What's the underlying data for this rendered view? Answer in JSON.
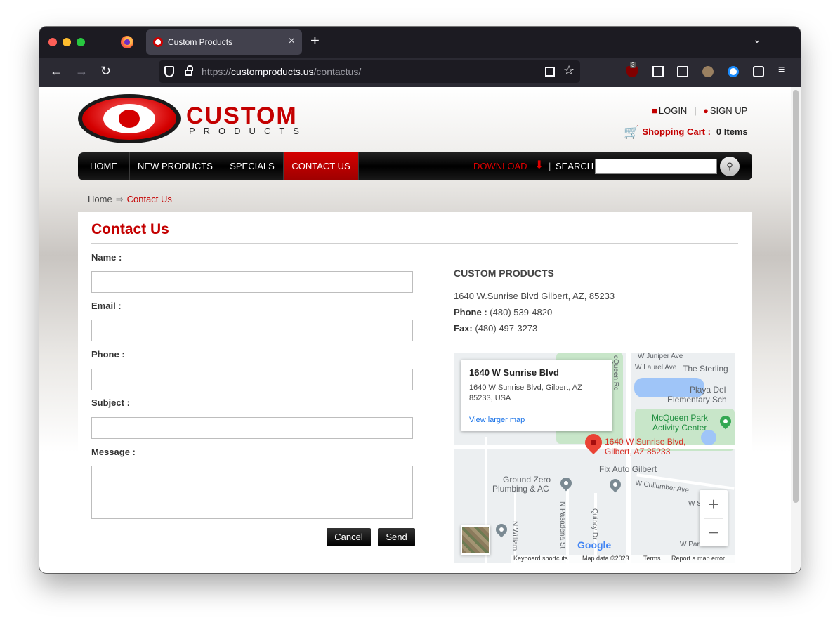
{
  "browser": {
    "tab_title": "Custom Products",
    "tab_close": "×",
    "new_tab": "+",
    "tab_list": "⌄",
    "url_scheme": "https://",
    "url_host": "customproducts.us",
    "url_path": "/contactus/",
    "ublock_badge": "3",
    "nav_back": "←",
    "nav_forward": "→",
    "nav_reload": "↻",
    "bookmark_star": "☆",
    "menu": "≡"
  },
  "header": {
    "logo_title": "CUSTOM",
    "logo_subtitle": "PRODUCTS",
    "login": "LOGIN",
    "account_sep": "|",
    "signup": "SIGN UP",
    "cart_label": "Shopping Cart :",
    "cart_count": "0 Items"
  },
  "nav": {
    "items": [
      "HOME",
      "NEW PRODUCTS",
      "SPECIALS",
      "CONTACT US"
    ],
    "active": "CONTACT US",
    "download": "DOWNLOAD",
    "separator": "|",
    "search_label": "SEARCH",
    "search_value": ""
  },
  "breadcrumb": {
    "home": "Home",
    "separator": "⇒",
    "current": "Contact Us"
  },
  "contact": {
    "title": "Contact Us",
    "fields": {
      "name_label": "Name :",
      "email_label": "Email :",
      "phone_label": "Phone :",
      "subject_label": "Subject :",
      "message_label": "Message :",
      "name_value": "",
      "email_value": "",
      "phone_value": "",
      "subject_value": "",
      "message_value": ""
    },
    "cancel_label": "Cancel",
    "send_label": "Send"
  },
  "company": {
    "name": "CUSTOM PRODUCTS",
    "address": "1640 W.Sunrise Blvd Gilbert, AZ, 85233",
    "phone_label": "Phone :",
    "phone": "(480) 539-4820",
    "fax_label": "Fax:",
    "fax": "(480) 497-3273"
  },
  "map": {
    "card_title": "1640 W Sunrise Blvd",
    "card_address": "1640 W Sunrise Blvd, Gilbert, AZ 85233, USA",
    "card_link": "View larger map",
    "pin_label_1": "1640 W Sunrise Blvd,",
    "pin_label_2": "Gilbert, AZ 85233",
    "poi_ground_zero_1": "Ground Zero",
    "poi_ground_zero_2": "Plumbing & AC",
    "poi_fix_auto": "Fix Auto Gilbert",
    "poi_mcqueen_1": "McQueen Park",
    "poi_mcqueen_2": "Activity Center",
    "poi_sterling": "The Sterling",
    "poi_playa_1": "Playa Del",
    "poi_playa_2": "Elementary Sch",
    "street_juniper": "W Juniper Ave",
    "street_laurel": "W Laurel Ave",
    "street_mcqueen": "cQueen Rd",
    "street_cullumber": "W Cullumber Ave",
    "street_pasadena": "N Pasadena St",
    "street_william": "N William",
    "street_quincy": "Quincy Dr",
    "street_ws": "W S",
    "street_wparl": "W Parl",
    "zoom_in": "+",
    "zoom_out": "−",
    "google": "Google",
    "attr_shortcuts": "Keyboard shortcuts",
    "attr_data": "Map data ©2023",
    "attr_terms": "Terms",
    "attr_report": "Report a map error"
  }
}
